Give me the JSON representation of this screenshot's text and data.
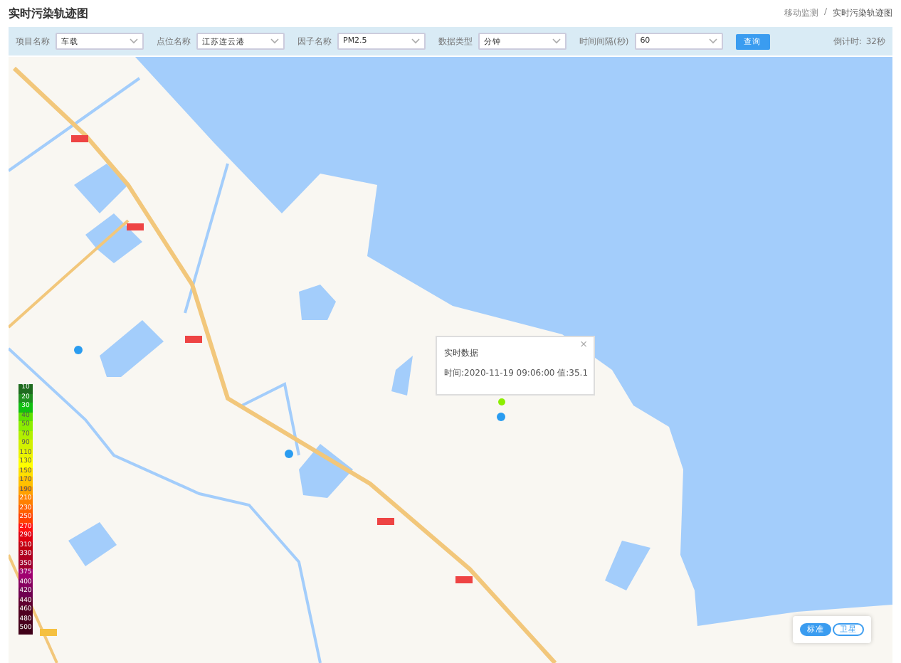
{
  "page_title": "实时污染轨迹图",
  "breadcrumb": [
    "移动监测",
    "实时污染轨迹图"
  ],
  "breadcrumb_separator": "/",
  "filters": [
    {
      "label": "项目名称",
      "value": "车载"
    },
    {
      "label": "点位名称",
      "value": "江苏连云港"
    },
    {
      "label": "因子名称",
      "value": "PM2.5"
    },
    {
      "label": "数据类型",
      "value": "分钟"
    },
    {
      "label": "时间间隔(秒)",
      "value": "60"
    }
  ],
  "query_button": "查询",
  "countdown": {
    "label": "倒计时:",
    "value": "32秒"
  },
  "legend": [
    {
      "label": "10",
      "color": "#1e6b1e"
    },
    {
      "label": "20",
      "color": "#1f8f1f"
    },
    {
      "label": "30",
      "color": "#10c010"
    },
    {
      "label": "40",
      "color": "#5fe000"
    },
    {
      "label": "50",
      "color": "#8cee00"
    },
    {
      "label": "70",
      "color": "#b2f000"
    },
    {
      "label": "90",
      "color": "#d2f000"
    },
    {
      "label": "110",
      "color": "#ecf400"
    },
    {
      "label": "130",
      "color": "#ffff00"
    },
    {
      "label": "150",
      "color": "#ffe000"
    },
    {
      "label": "170",
      "color": "#ffc000"
    },
    {
      "label": "190",
      "color": "#ffa000"
    },
    {
      "label": "210",
      "color": "#ff8000"
    },
    {
      "label": "230",
      "color": "#ff6000"
    },
    {
      "label": "250",
      "color": "#ff4000"
    },
    {
      "label": "270",
      "color": "#ff1010"
    },
    {
      "label": "290",
      "color": "#e00010"
    },
    {
      "label": "310",
      "color": "#c00010"
    },
    {
      "label": "330",
      "color": "#b00020"
    },
    {
      "label": "350",
      "color": "#a00030"
    },
    {
      "label": "375",
      "color": "#a00070"
    },
    {
      "label": "400",
      "color": "#880060"
    },
    {
      "label": "420",
      "color": "#700050"
    },
    {
      "label": "440",
      "color": "#600030"
    },
    {
      "label": "460",
      "color": "#500020"
    },
    {
      "label": "480",
      "color": "#48001c"
    },
    {
      "label": "500",
      "color": "#400018"
    }
  ],
  "popup": {
    "title": "实时数据",
    "close": "×",
    "text": "时间:2020-11-19 09:06:00 值:35.1"
  },
  "map_types": [
    {
      "label": "标准",
      "selected": true
    },
    {
      "label": "卫星",
      "selected": false
    }
  ]
}
